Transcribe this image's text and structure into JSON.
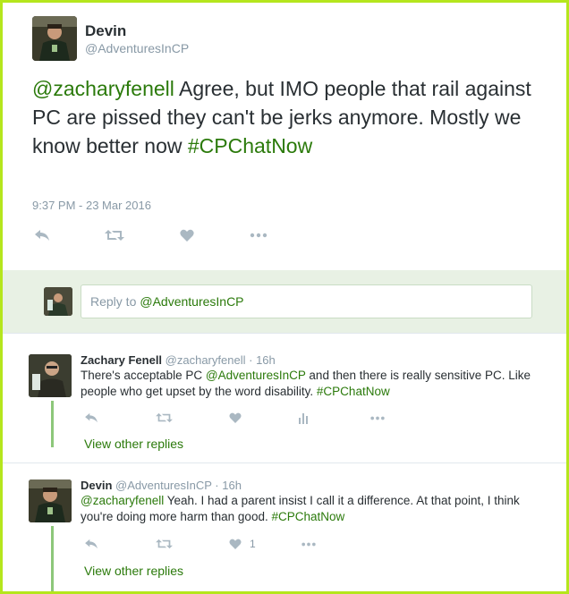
{
  "main_tweet": {
    "name": "Devin",
    "handle": "@AdventuresInCP",
    "mention": "@zacharyfenell",
    "text": " Agree, but IMO people that rail against PC are pissed they can't be jerks anymore. Mostly we know better now ",
    "hashtag": "#CPChatNow",
    "timestamp": "9:37 PM - 23 Mar 2016",
    "icons": [
      "reply-icon",
      "retweet-icon",
      "like-icon",
      "more-icon"
    ]
  },
  "reply_box": {
    "prefix": "Reply to",
    "mention": "@AdventuresInCP"
  },
  "replies": [
    {
      "name": "Zachary Fenell",
      "handle": "@zacharyfenell",
      "time": "16h",
      "text_1": "There's acceptable PC ",
      "mention": "@AdventuresInCP",
      "text_2": " and then there is really sensitive PC. Like people who get upset by the word disability. ",
      "hashtag": "#CPChatNow",
      "like_count": "",
      "view_other": "View other replies"
    },
    {
      "name": "Devin",
      "handle": "@AdventuresInCP",
      "time": "16h",
      "mention": "@zacharyfenell",
      "text_1": " Yeah. I had a parent insist I call it a difference. At that point, I think you're doing more harm than good. ",
      "hashtag": "#CPChatNow",
      "like_count": "1",
      "view_other": "View other replies"
    }
  ],
  "colors": {
    "link": "#2b7a0b",
    "border": "#b5e61d",
    "reply_bg": "#e8f1e4",
    "thread_line": "#8dc77a",
    "muted": "#8899a6"
  }
}
